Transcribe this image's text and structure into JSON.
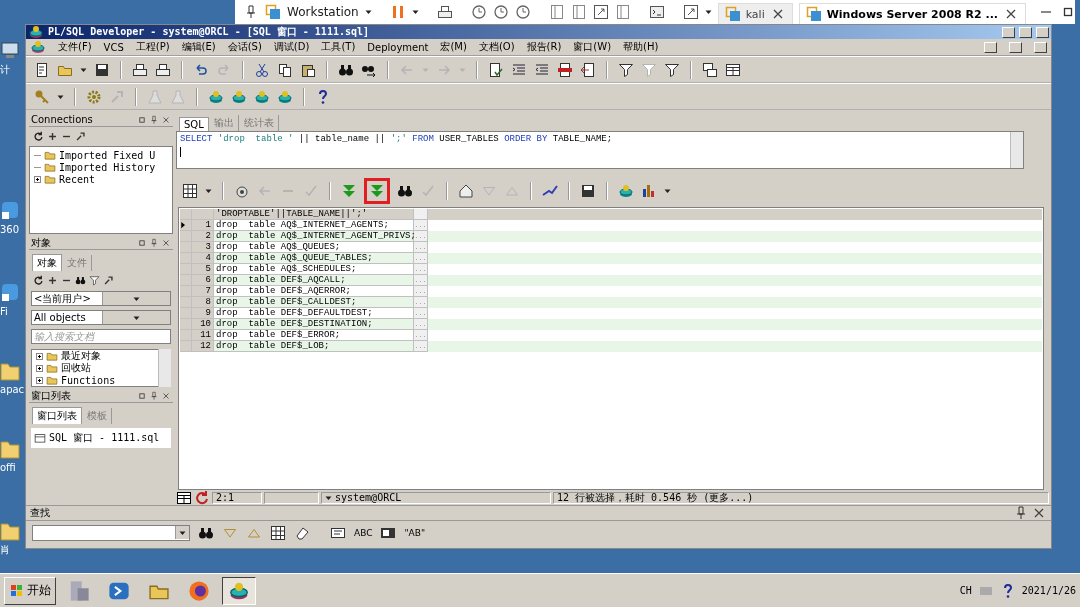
{
  "vmware_bar": {
    "title": "Workstation",
    "tabs": [
      {
        "label": "kali",
        "selected": false
      },
      {
        "label": "Windows Server 2008 R2 ...",
        "selected": true
      }
    ]
  },
  "desktop_icons": [
    {
      "kind": "computer",
      "label": "计"
    },
    {
      "kind": "shortcut",
      "label": "360"
    },
    {
      "kind": "shortcut",
      "label": "Fi"
    },
    {
      "kind": "folder",
      "label": "apac"
    },
    {
      "kind": "folder",
      "label": "offi"
    },
    {
      "kind": "folder",
      "label": "肖"
    }
  ],
  "window": {
    "title": "PL/SQL Developer - system@ORCL - [SQL 窗口 - 1111.sql]"
  },
  "menu": [
    "文件(F)",
    "VCS",
    "工程(P)",
    "编辑(E)",
    "会话(S)",
    "调试(D)",
    "工具(T)",
    "Deployment",
    "宏(M)",
    "文档(O)",
    "报告(R)",
    "窗口(W)",
    "帮助(H)"
  ],
  "toolbar_1": [
    {
      "disabled": false
    },
    {
      "disabled": false
    },
    {
      "disabled": false
    },
    {
      "disabled": false
    },
    {
      "disabled": false
    },
    {
      "disabled": false
    },
    {
      "disabled": false
    },
    {
      "disabled": true
    },
    {
      "disabled": false
    },
    {
      "disabled": false
    },
    {
      "disabled": false
    },
    {
      "disabled": false
    },
    {
      "disabled": false
    },
    {
      "disabled": true
    },
    {
      "disabled": true
    },
    {
      "disabled": true
    },
    {
      "disabled": true
    },
    {
      "disabled": false
    },
    {
      "disabled": false
    },
    {
      "disabled": false
    },
    {
      "disabled": false
    },
    {
      "disabled": false
    },
    {
      "disabled": false
    },
    {
      "disabled": true
    },
    {
      "disabled": false
    },
    {
      "disabled": false
    },
    {
      "disabled": false
    }
  ],
  "toolbar_2": [
    {
      "disabled": false
    },
    {
      "disabled": false
    },
    {
      "disabled": false
    },
    {
      "disabled": true
    },
    {
      "disabled": true
    },
    {
      "disabled": true
    },
    {
      "disabled": false
    },
    {
      "disabled": false
    },
    {
      "disabled": false
    },
    {
      "disabled": false
    },
    {
      "disabled": false
    }
  ],
  "connections": {
    "title": "Connections",
    "items": [
      {
        "label": "Imported Fixed U",
        "expander": false
      },
      {
        "label": "Imported History",
        "expander": false
      },
      {
        "label": "Recent",
        "expander": true
      }
    ]
  },
  "objects_panel": {
    "title": "对象",
    "tabs": [
      {
        "label": "对象",
        "selected": true
      },
      {
        "label": "文件",
        "selected": false
      }
    ],
    "user_select": "<当前用户>",
    "type_select": "All objects",
    "search_placeholder": "输入搜索文档",
    "tree": [
      {
        "label": "最近对象",
        "expander": true
      },
      {
        "label": "回收站",
        "expander": true
      },
      {
        "label": "Functions",
        "expander": true
      }
    ]
  },
  "window_list": {
    "title": "窗口列表",
    "tabs": [
      {
        "label": "窗口列表",
        "selected": true
      },
      {
        "label": "模板",
        "selected": false
      }
    ],
    "items": [
      {
        "label": "SQL 窗口 - 1111.sql"
      }
    ]
  },
  "editor": {
    "tabs": [
      {
        "label": "SQL",
        "selected": true
      },
      {
        "label": "输出",
        "selected": false
      },
      {
        "label": "统计表",
        "selected": false
      }
    ],
    "sql": [
      {
        "kind": "keyword",
        "text": "SELECT"
      },
      {
        "kind": "string",
        "text": "'drop  table '"
      },
      {
        "kind": "plain",
        "text": "|| table_name ||"
      },
      {
        "kind": "string",
        "text": "';'"
      },
      {
        "kind": "keyword",
        "text": "FROM"
      },
      {
        "kind": "plain",
        "text": "USER_TABLES"
      },
      {
        "kind": "keyword",
        "text": "ORDER BY"
      },
      {
        "kind": "plain",
        "text": "TABLE_NAME;"
      }
    ]
  },
  "results": {
    "toolbar": [
      {
        "disabled": false
      },
      {
        "disabled": false
      },
      {
        "disabled": false
      },
      {
        "disabled": true
      },
      {
        "disabled": true
      },
      {
        "disabled": true
      },
      {
        "disabled": false
      },
      {
        "disabled": false,
        "highlighted": true
      },
      {
        "disabled": false
      },
      {
        "disabled": true
      },
      {
        "disabled": false
      },
      {
        "disabled": true
      },
      {
        "disabled": true
      },
      {
        "disabled": false
      },
      {
        "disabled": false
      },
      {
        "disabled": false
      },
      {
        "disabled": false
      },
      {
        "disabled": false
      }
    ],
    "column": "'DROPTABLE'||TABLE_NAME||';'",
    "rows": [
      {
        "number": "1",
        "value": "drop  table AQ$_INTERNET_AGENTS;",
        "more": "...",
        "selected": true
      },
      {
        "number": "2",
        "value": "drop  table AQ$_INTERNET_AGENT_PRIVS;",
        "more": "...",
        "selected": false
      },
      {
        "number": "3",
        "value": "drop  table AQ$_QUEUES;",
        "more": "...",
        "selected": false
      },
      {
        "number": "4",
        "value": "drop  table AQ$_QUEUE_TABLES;",
        "more": "...",
        "selected": false
      },
      {
        "number": "5",
        "value": "drop  table AQ$_SCHEDULES;",
        "more": "...",
        "selected": false
      },
      {
        "number": "6",
        "value": "drop  table DEF$_AQCALL;",
        "more": "...",
        "selected": false
      },
      {
        "number": "7",
        "value": "drop  table DEF$_AQERROR;",
        "more": "...",
        "selected": false
      },
      {
        "number": "8",
        "value": "drop  table DEF$_CALLDEST;",
        "more": "...",
        "selected": false
      },
      {
        "number": "9",
        "value": "drop  table DEF$_DEFAULTDEST;",
        "more": "...",
        "selected": false
      },
      {
        "number": "10",
        "value": "drop  table DEF$_DESTINATION;",
        "more": "...",
        "selected": false
      },
      {
        "number": "11",
        "value": "drop  table DEF$_ERROR;",
        "more": "...",
        "selected": false
      },
      {
        "number": "12",
        "value": "drop  table DEF$_LOB;",
        "more": "...",
        "selected": false
      }
    ]
  },
  "status_bar": {
    "position": "2:1",
    "connection": "system@ORCL",
    "message": "12 行被选择，耗时 0.546 秒 (更多...)"
  },
  "find_panel": {
    "title": "查找",
    "text_buttons": [
      "ABC",
      "\"AB\""
    ]
  },
  "taskbar": {
    "start": "开始",
    "language": "CH",
    "date": "2021/1/26"
  }
}
